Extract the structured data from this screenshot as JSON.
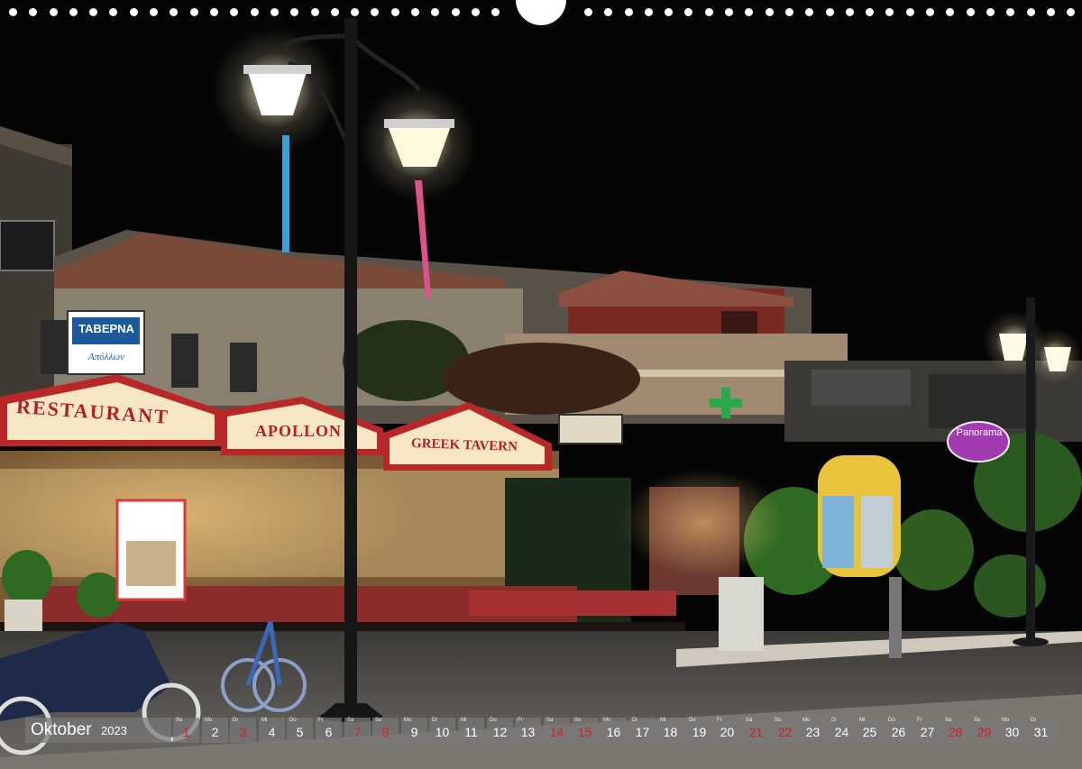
{
  "calendar": {
    "month": "Oktober",
    "year": "2023",
    "days": [
      {
        "dn": "So",
        "d": "1",
        "we": true
      },
      {
        "dn": "Mo",
        "d": "2",
        "we": false
      },
      {
        "dn": "Di",
        "d": "3",
        "we": true
      },
      {
        "dn": "Mi",
        "d": "4",
        "we": false
      },
      {
        "dn": "Do",
        "d": "5",
        "we": false
      },
      {
        "dn": "Fr",
        "d": "6",
        "we": false
      },
      {
        "dn": "Sa",
        "d": "7",
        "we": true
      },
      {
        "dn": "So",
        "d": "8",
        "we": true
      },
      {
        "dn": "Mo",
        "d": "9",
        "we": false
      },
      {
        "dn": "Di",
        "d": "10",
        "we": false
      },
      {
        "dn": "Mi",
        "d": "11",
        "we": false
      },
      {
        "dn": "Do",
        "d": "12",
        "we": false
      },
      {
        "dn": "Fr",
        "d": "13",
        "we": false
      },
      {
        "dn": "Sa",
        "d": "14",
        "we": true
      },
      {
        "dn": "So",
        "d": "15",
        "we": true
      },
      {
        "dn": "Mo",
        "d": "16",
        "we": false
      },
      {
        "dn": "Di",
        "d": "17",
        "we": false
      },
      {
        "dn": "Mi",
        "d": "18",
        "we": false
      },
      {
        "dn": "Do",
        "d": "19",
        "we": false
      },
      {
        "dn": "Fr",
        "d": "20",
        "we": false
      },
      {
        "dn": "Sa",
        "d": "21",
        "we": true
      },
      {
        "dn": "So",
        "d": "22",
        "we": true
      },
      {
        "dn": "Mo",
        "d": "23",
        "we": false
      },
      {
        "dn": "Di",
        "d": "24",
        "we": false
      },
      {
        "dn": "Mi",
        "d": "25",
        "we": false
      },
      {
        "dn": "Do",
        "d": "26",
        "we": false
      },
      {
        "dn": "Fr",
        "d": "27",
        "we": false
      },
      {
        "dn": "Sa",
        "d": "28",
        "we": true
      },
      {
        "dn": "So",
        "d": "29",
        "we": true
      },
      {
        "dn": "Mo",
        "d": "30",
        "we": false
      },
      {
        "dn": "Di",
        "d": "31",
        "we": false
      }
    ]
  },
  "signs": {
    "restaurant": "RESTAURANT",
    "apollon": "APOLLON",
    "greek_tavern": "GREEK TAVERN",
    "taverna": "ΤΑΒΕΡΝΑ",
    "taverna_sub": "Απόλλων",
    "panorama": "Panorama"
  },
  "colors": {
    "weekend": "#d81e1e",
    "strip": "#787878",
    "sky": "#050505"
  }
}
